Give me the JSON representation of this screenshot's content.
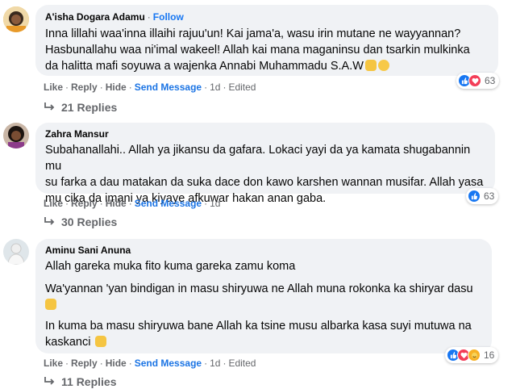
{
  "comments": [
    {
      "author": "A'isha Dogara Adamu",
      "follow_label": "Follow",
      "text_lines": [
        "Inna lillahi waa'inna illaihi rajuu'un! Kai jama'a, wasu irin mutane ne wayyannan?",
        "Hasbunallahu waa ni'imal wakeel! Allah kai mana maganinsu dan tsarkin mulkinka",
        "da halitta mafi soyuwa a wajenka Annabi Muhammadu S.A.W"
      ],
      "actions": {
        "like": "Like",
        "reply": "Reply",
        "hide": "Hide",
        "send": "Send Message",
        "time": "1d",
        "edited": "Edited"
      },
      "reaction_count": "63",
      "reaction_icons": [
        "like-icon",
        "love-icon"
      ],
      "replies_label": "21 Replies"
    },
    {
      "author": "Zahra Mansur",
      "text_lines": [
        "Subahanallahi.. Allah ya jikansu da gafara. Lokaci yayi da ya kamata shugabannin mu",
        "su farka a dau matakan da suka dace don kawo karshen wannan musifar. Allah yasa",
        "mu cika da imani ya kiyaye afkuwar hakan anan gaba."
      ],
      "actions": {
        "like": "Like",
        "reply": "Reply",
        "hide": "Hide",
        "send": "Send Message",
        "time": "1d"
      },
      "reaction_count": "63",
      "reaction_icons": [
        "like-icon"
      ],
      "replies_label": "30 Replies"
    },
    {
      "author": "Aminu Sani Anuna",
      "paragraphs": [
        "Allah gareka muka fito kuma gareka zamu koma",
        "Wa'yannan 'yan bindigan in masu shiryuwa ne Allah muna rokonka ka shiryar dasu",
        "In kuma ba masu shiryuwa bane Allah ka tsine musu albarka kasa suyi mutuwa na",
        "kaskanci"
      ],
      "actions": {
        "like": "Like",
        "reply": "Reply",
        "hide": "Hide",
        "send": "Send Message",
        "time": "1d",
        "edited": "Edited"
      },
      "reaction_count": "16",
      "reaction_icons": [
        "like-icon",
        "love-icon",
        "care-icon"
      ],
      "replies_label": "11 Replies"
    }
  ]
}
